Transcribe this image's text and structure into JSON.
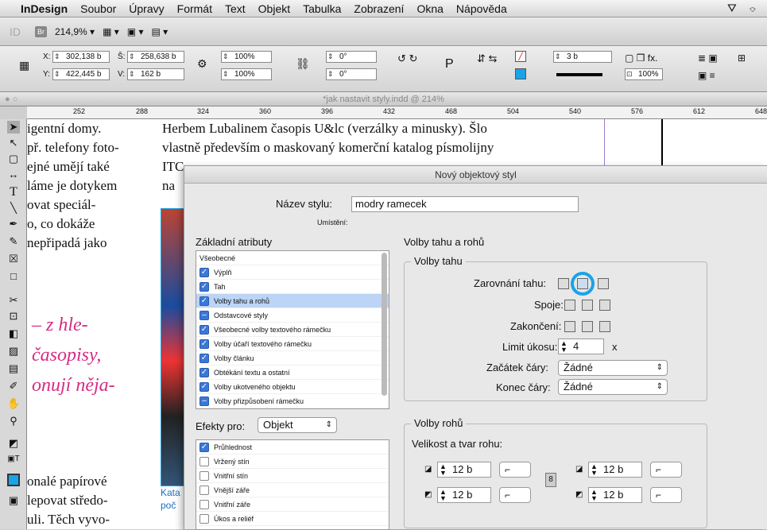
{
  "menubar": {
    "app": "InDesign",
    "items": [
      "Soubor",
      "Úpravy",
      "Formát",
      "Text",
      "Objekt",
      "Tabulka",
      "Zobrazení",
      "Okna",
      "Nápověda"
    ]
  },
  "appbar": {
    "logo": "ID",
    "bridge": "Br",
    "zoom": "214,9% ▾"
  },
  "control": {
    "x_label": "X:",
    "x": "302,138 b",
    "y_label": "Y:",
    "y": "422,445 b",
    "w_label": "Š:",
    "w": "258,638 b",
    "h_label": "V:",
    "h": "162 b",
    "scale_x": "100%",
    "scale_y": "100%",
    "rotate": "0°",
    "shear": "0°",
    "stroke_weight": "3 b",
    "opacity": "100%"
  },
  "document": {
    "title": "*jak nastavit styly.indd @ 214%",
    "ruler": [
      "252",
      "288",
      "324",
      "360",
      "396",
      "432",
      "468",
      "504",
      "540",
      "576",
      "612",
      "648"
    ],
    "left_col": [
      "igentní domy.",
      "př. telefony foto-",
      "ejné umějí také",
      "láme je dotykem",
      "ovat speciál-",
      "o, co dokáže",
      " nepřipadá jako"
    ],
    "pink": [
      "– z hle-",
      "časopisy,",
      "onují něja-"
    ],
    "left_bottom": [
      "onalé papírové",
      "lepovat středo-",
      "uli. Těch vyvo-"
    ],
    "right_col": [
      "Herbem Lubalinem  časopis U&lc (verzálky a minusky). Šlo",
      "vlastně především o maskovaný komerční katalog písmolijny",
      "ITC",
      "na"
    ],
    "caption": [
      "Kata",
      "poč"
    ]
  },
  "dialog": {
    "title": "Nový objektový styl",
    "name_label": "Název stylu:",
    "name_value": "modry ramecek",
    "location_label": "Umístění:",
    "basic_attrs_label": "Základní atributy",
    "basic_attrs": [
      {
        "label": "Všeobecné",
        "state": "none"
      },
      {
        "label": "Výplň",
        "state": "on"
      },
      {
        "label": "Tah",
        "state": "on"
      },
      {
        "label": "Volby tahu a rohů",
        "state": "on"
      },
      {
        "label": "Odstavcové styly",
        "state": "ind"
      },
      {
        "label": "Všeobecné volby textového rámečku",
        "state": "on"
      },
      {
        "label": "Volby účaří textového rámečku",
        "state": "on"
      },
      {
        "label": "Volby článku",
        "state": "on"
      },
      {
        "label": "Obtékání textu a ostatní",
        "state": "on"
      },
      {
        "label": "Volby ukotveného objektu",
        "state": "on"
      },
      {
        "label": "Volby přizpůsobení rámečku",
        "state": "ind"
      }
    ],
    "effects_label": "Efekty pro:",
    "effects_select": "Objekt",
    "effects": [
      {
        "label": "Průhlednost",
        "state": "on"
      },
      {
        "label": "Vržený stín",
        "state": "off"
      },
      {
        "label": "Vnitřní stín",
        "state": "off"
      },
      {
        "label": "Vnější záře",
        "state": "off"
      },
      {
        "label": "Vnitřní záře",
        "state": "off"
      },
      {
        "label": "Úkos a reliéf",
        "state": "off"
      }
    ],
    "section_title": "Volby tahu a rohů",
    "stroke_group": "Volby tahu",
    "stroke_align_label": "Zarovnání tahu:",
    "joins_label": "Spoje:",
    "caps_label": "Zakončení:",
    "miter_label": "Limit úkosu:",
    "miter_value": "4",
    "miter_unit": "x",
    "start_label": "Začátek čáry:",
    "start_value": "Žádné",
    "end_label": "Konec čáry:",
    "end_value": "Žádné",
    "corner_group": "Volby rohů",
    "corner_size_label": "Velikost a tvar rohu:",
    "corner_values": [
      "12 b",
      "12 b",
      "12 b",
      "12 b"
    ],
    "corner_shape": "⌐"
  },
  "colors": {
    "highlight": "#1aa3e8",
    "pink": "#d62b84",
    "selection": "#bcd4f5"
  }
}
